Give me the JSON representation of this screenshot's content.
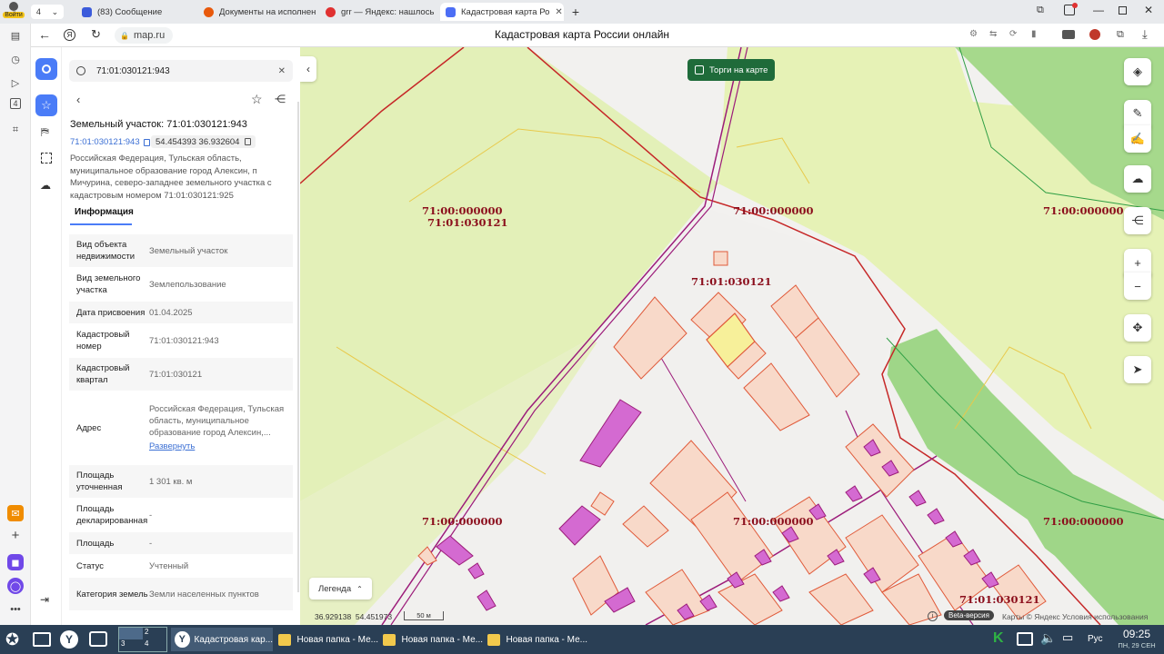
{
  "tabs": [
    {
      "title": "(83) Сообщение",
      "favicon_color": "#3b5bdb"
    },
    {
      "title": "Документы на исполнен",
      "favicon_color": "#e8590c"
    },
    {
      "title": "grr — Яндекс: нашлось",
      "favicon_color": "#e03131"
    },
    {
      "title": "Кадастровая карта Ро",
      "favicon_color": "#4c6ef5",
      "active": true
    }
  ],
  "browser": {
    "profile_label": "Войти",
    "tab_count": "4",
    "url": "map.ru",
    "page_title": "Кадастровая карта России онлайн"
  },
  "search": {
    "value": "71:01:030121:943"
  },
  "object": {
    "title": "Земельный участок: 71:01:030121:943",
    "number_link": "71:01:030121:943",
    "coords": "54.454393 36.932604",
    "address": "Российская Федерация, Тульская область, муниципальное образование город Алексин, п Мичурина, северо-западнее земельного участка с кадастровым номером 71:01:030121:925",
    "tab": "Информация"
  },
  "properties": [
    {
      "key": "Вид объекта недвижимости",
      "value": "Земельный участок"
    },
    {
      "key": "Вид земельного участка",
      "value": "Землепользование"
    },
    {
      "key": "Дата присвоения",
      "value": "01.04.2025"
    },
    {
      "key": "Кадастровый номер",
      "value": "71:01:030121:943"
    },
    {
      "key": "Кадастровый квартал",
      "value": "71:01:030121"
    },
    {
      "key": "Адрес",
      "value": "Российская Федерация, Тульская область, муниципальное образование город Алексин,..."
    },
    {
      "key": "Площадь уточненная",
      "value": "1 301 кв. м"
    },
    {
      "key": "Площадь декларированная",
      "value": "-"
    },
    {
      "key": "Площадь",
      "value": "-"
    },
    {
      "key": "Статус",
      "value": "Учтенный"
    },
    {
      "key": "Категория земель",
      "value": "Земли населенных пунктов"
    }
  ],
  "expand_label": "Развернуть",
  "map": {
    "torgi_label": "Торги на карте",
    "labels": [
      "71:00:000000",
      "71:01:030121",
      "71:00:000000",
      "71:00:000000",
      "71:01:030121",
      "71:00:000000",
      "71:00:000000",
      "71:00:000000",
      "71:01:030121"
    ],
    "legend": "Легенда",
    "coords_readout": "36.929138  54.451973",
    "scale": "50 м",
    "beta": "Beta-версия",
    "copyright": "Карты © Яндекс",
    "terms": "Условия использования"
  },
  "taskbar": {
    "workspaces": [
      "1",
      "2",
      "3",
      "4"
    ],
    "windows": [
      "Кадастровая кар...",
      "Новая папка - Ме...",
      "Новая папка - Ме...",
      "Новая папка - Ме..."
    ],
    "lang": "Рус",
    "time": "09:25",
    "date": "ПН, 29 СЕН"
  },
  "colors": {
    "accent": "#4a7cf7",
    "torgi": "#1f6b3a",
    "boundary": "#e05a3a",
    "label": "#8b0e1c",
    "taskbar": "#2a3f55"
  }
}
